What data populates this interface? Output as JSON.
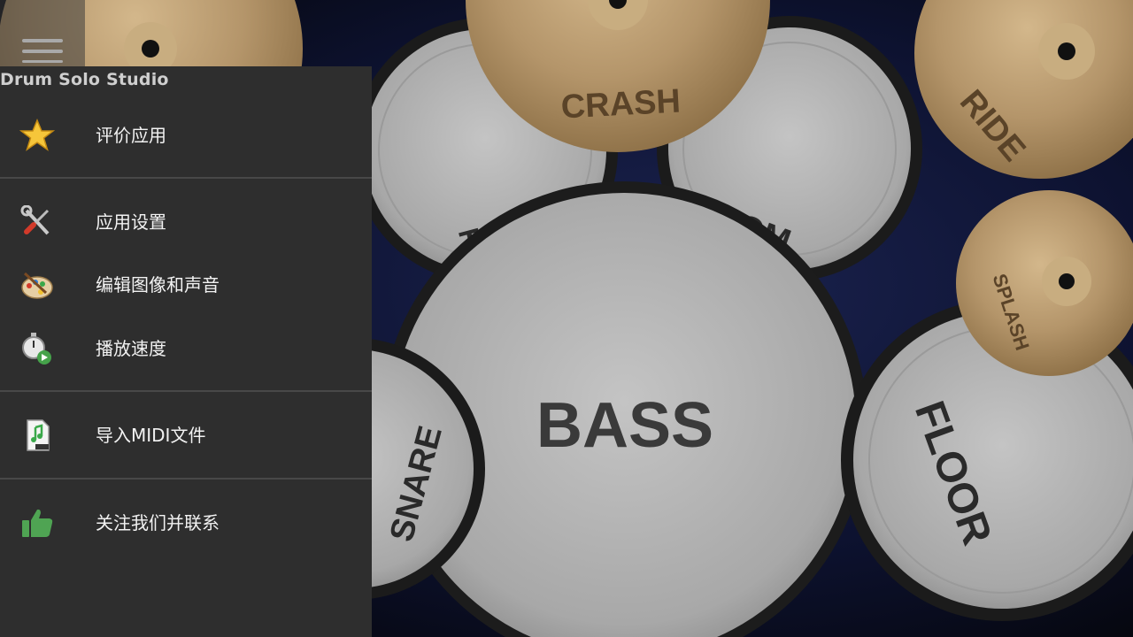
{
  "app": {
    "title": "Drum Solo Studio"
  },
  "menu": {
    "items": [
      {
        "label": "评价应用",
        "icon": "star-icon"
      },
      {
        "label": "应用设置",
        "icon": "tools-icon"
      },
      {
        "label": "编辑图像和声音",
        "icon": "palette-icon"
      },
      {
        "label": "播放速度",
        "icon": "stopwatch-icon"
      },
      {
        "label": "导入MIDI文件",
        "icon": "midi-file-icon"
      },
      {
        "label": "关注我们并联系",
        "icon": "thumbs-up-icon"
      }
    ]
  },
  "drums": {
    "crash": "CRASH",
    "ride": "RIDE",
    "splash": "SPLASH",
    "tom_left": "TOM",
    "tom_right": "TOM",
    "bass": "BASS",
    "snare": "SNARE",
    "floor": "FLOOR"
  },
  "colors": {
    "drawer_bg": "#2e2e2e",
    "divider": "#484848",
    "text": "#f2f2f2",
    "cymbal": "#b99a6c",
    "drumhead": "#b2b2b2"
  }
}
